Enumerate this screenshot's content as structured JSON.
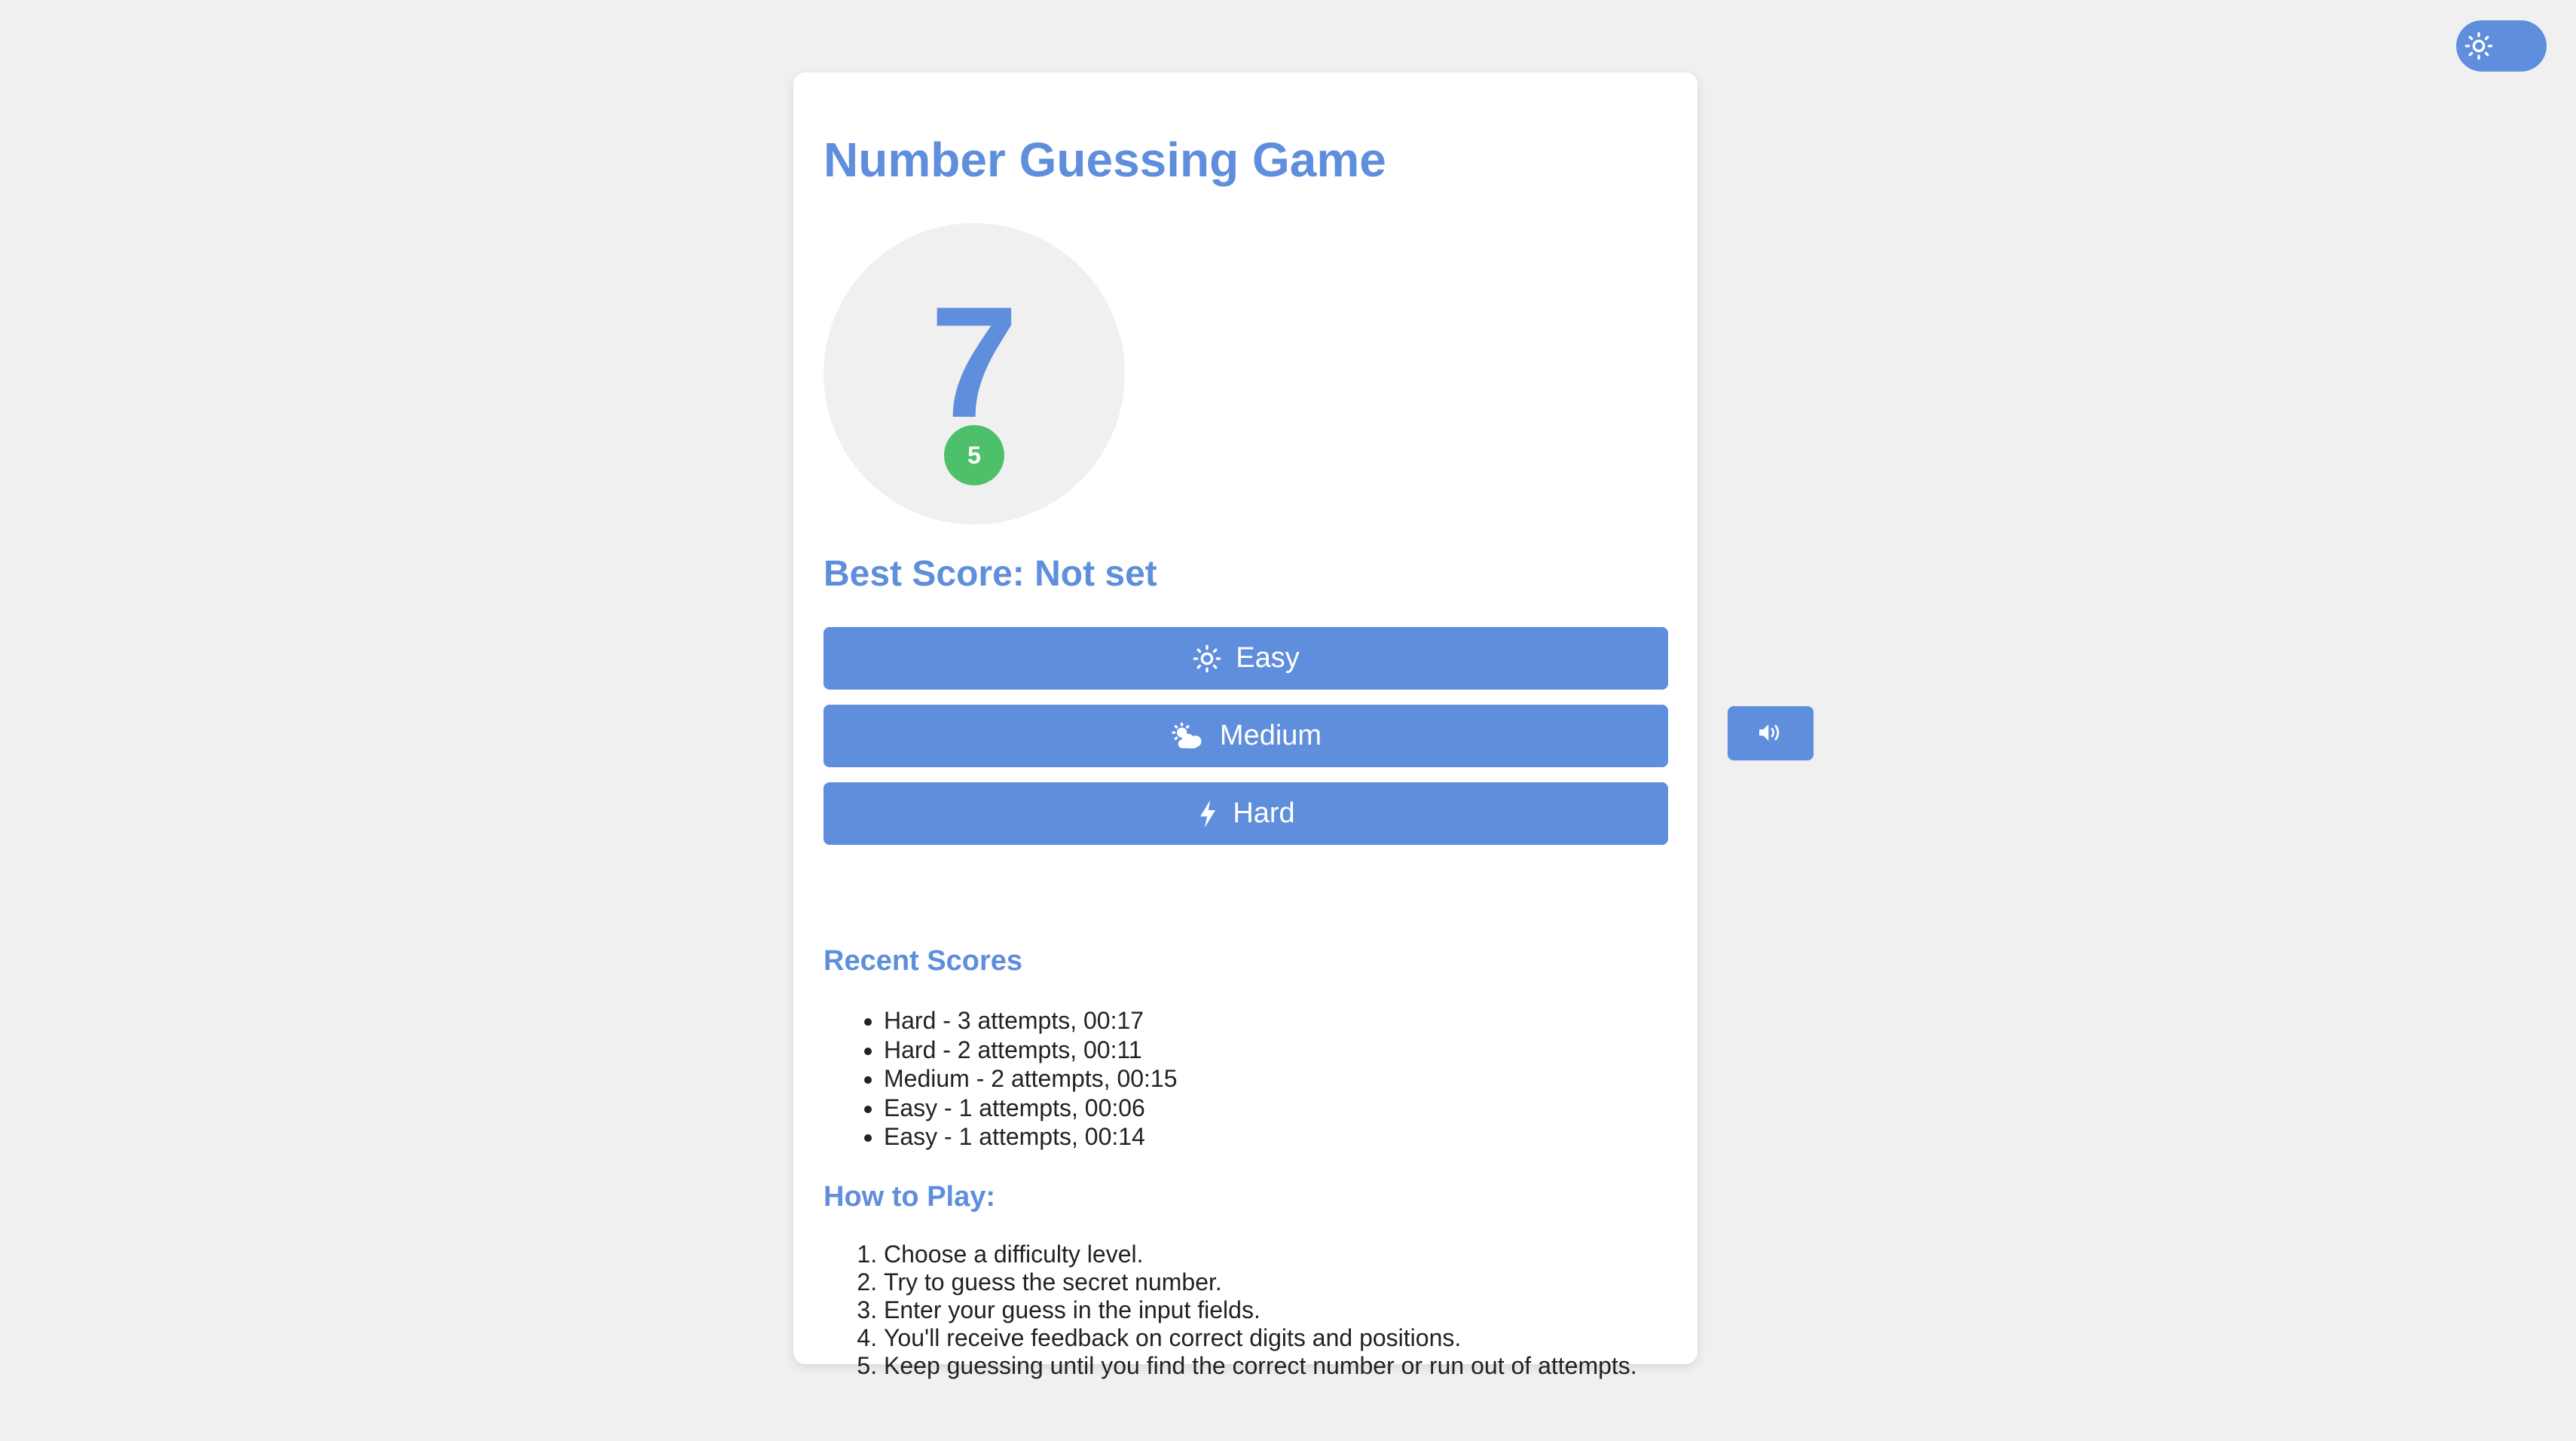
{
  "colors": {
    "background": "#f0f0f0",
    "accent": "#5e8edc",
    "success": "#4fc06a",
    "card": "#ffffff",
    "text": "#222222"
  },
  "theme_toggle": {
    "icon": "sun-icon",
    "state": "light"
  },
  "game": {
    "title": "Number Guessing Game",
    "current_number": "7",
    "attempts_badge": "5",
    "best_score": "Best Score: Not set"
  },
  "difficulty": {
    "easy": {
      "label": "Easy",
      "icon": "sun-icon"
    },
    "medium": {
      "label": "Medium",
      "icon": "cloud-sun-icon"
    },
    "hard": {
      "label": "Hard",
      "icon": "bolt-icon"
    }
  },
  "recent_scores": {
    "title": "Recent Scores",
    "items": [
      "Hard - 3 attempts, 00:17",
      "Hard - 2 attempts, 00:11",
      "Medium - 2 attempts, 00:15",
      "Easy - 1 attempts, 00:06",
      "Easy - 1 attempts, 00:14"
    ]
  },
  "how_to_play": {
    "title": "How to Play:",
    "steps": [
      "Choose a difficulty level.",
      "Try to guess the secret number.",
      "Enter your guess in the input fields.",
      "You'll receive feedback on correct digits and positions.",
      "Keep guessing until you find the correct number or run out of attempts."
    ]
  },
  "sound_button": {
    "icon": "volume-icon"
  }
}
